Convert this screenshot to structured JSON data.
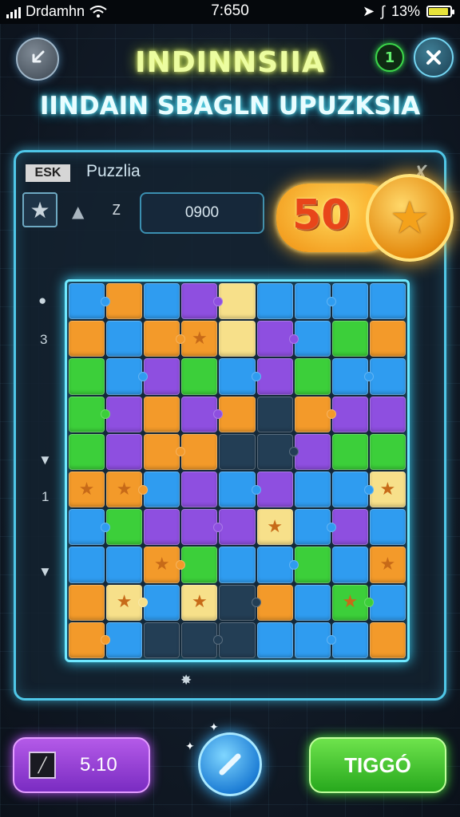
{
  "status_bar": {
    "carrier": "Drdamhn",
    "time": "7:650",
    "battery": "13%",
    "battery_level": 0.85
  },
  "header": {
    "title_line1": "INDINNSIIA",
    "title_line2": "IINDAIN SBAGLN UPUZKSIA",
    "back_icon": "back-arrow-icon",
    "hint_label": "1",
    "close_icon": "close-icon"
  },
  "panel": {
    "badge": "ESK",
    "label": "Puzzlia",
    "score": "0900",
    "rotate_label": "Z",
    "side_labels": [
      "3",
      "1"
    ]
  },
  "reward": {
    "value": "50",
    "icon": "star-coin-icon"
  },
  "board": {
    "rows": [
      [
        "b",
        "o",
        "b",
        "p",
        "y",
        "b",
        "b",
        "b",
        "b"
      ],
      [
        "o",
        "b",
        "o",
        "o",
        "y",
        "p",
        "b",
        "g",
        "o"
      ],
      [
        "g",
        "b",
        "p",
        "g",
        "b",
        "p",
        "g",
        "b",
        "b"
      ],
      [
        "g",
        "p",
        "o",
        "p",
        "o",
        "d",
        "o",
        "p",
        "p"
      ],
      [
        "g",
        "p",
        "o",
        "o",
        "d",
        "d",
        "p",
        "g",
        "g"
      ],
      [
        "o",
        "o",
        "b",
        "p",
        "b",
        "p",
        "b",
        "b",
        "y"
      ],
      [
        "b",
        "g",
        "p",
        "p",
        "p",
        "y",
        "b",
        "p",
        "b"
      ],
      [
        "b",
        "b",
        "o",
        "g",
        "b",
        "b",
        "g",
        "b",
        "o"
      ],
      [
        "o",
        "y",
        "b",
        "y",
        "d",
        "o",
        "b",
        "g",
        "b"
      ],
      [
        "o",
        "b",
        "d",
        "d",
        "d",
        "b",
        "b",
        "b",
        "o"
      ]
    ],
    "stars": [
      [
        1,
        3
      ],
      [
        5,
        0
      ],
      [
        5,
        1
      ],
      [
        6,
        5
      ],
      [
        7,
        2
      ],
      [
        8,
        1
      ],
      [
        8,
        3
      ],
      [
        8,
        7
      ],
      [
        5,
        8
      ],
      [
        7,
        8
      ]
    ]
  },
  "bottom": {
    "left_value": "5.10",
    "left_icon": "tool-icon",
    "center_icon": "magic-wand-icon",
    "go_label": "TIGGÓ"
  },
  "colors": {
    "blue": "#2f9cf0",
    "green": "#3ccf3a",
    "purple": "#8e4fe0",
    "orange": "#f39a2a",
    "yellow": "#f7e08a",
    "dark": "#233e55"
  }
}
